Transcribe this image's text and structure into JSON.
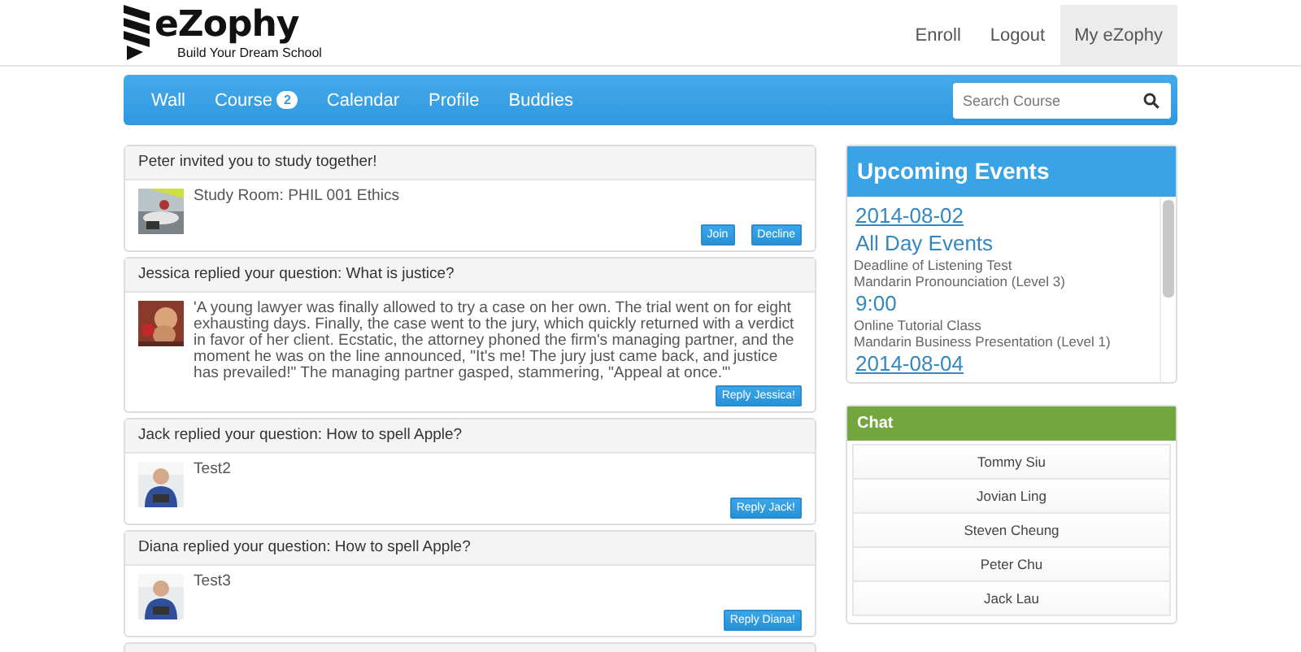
{
  "brand": {
    "name": "eZophy",
    "tagline": "Build Your Dream School"
  },
  "top_nav": [
    {
      "label": "Enroll",
      "selected": false
    },
    {
      "label": "Logout",
      "selected": false
    },
    {
      "label": "My eZophy",
      "selected": true
    }
  ],
  "main_nav": [
    {
      "label": "Wall"
    },
    {
      "label": "Course",
      "badge": "2"
    },
    {
      "label": "Calendar"
    },
    {
      "label": "Profile"
    },
    {
      "label": "Buddies"
    }
  ],
  "search": {
    "placeholder": "Search Course"
  },
  "posts": [
    {
      "title": "Peter invited you to study together!",
      "picture": {
        "kind": "picture"
      },
      "body": "Study Room: PHIL 001 Ethics",
      "buttons": [
        "Join",
        "Decline"
      ]
    },
    {
      "title": "Jessica replied your question: What is justice?",
      "picture": {
        "kind": "picture"
      },
      "body": "'A young lawyer was finally allowed to try a case on her own. The trial went on for eight exhausting days. Finally, the case went to the jury, which quickly returned with a verdict in favor of her client. Ecstatic, the attorney phoned the firm's managing partner, and the moment he was on the line announced, \"It's me! The jury just came back, and justice has prevailed!\" The managing partner gasped, stammering, \"Appeal at once.\"'",
      "buttons": [
        "Reply Jessica!"
      ]
    },
    {
      "title": "Jack replied your question: How to spell Apple?",
      "picture": {
        "kind": "picture"
      },
      "body": "Test2",
      "buttons": [
        "Reply Jack!"
      ]
    },
    {
      "title": "Diana replied your question: How to spell Apple?",
      "picture": {
        "kind": "picture"
      },
      "body": "Test3",
      "buttons": [
        "Reply Diana!"
      ]
    }
  ],
  "events": {
    "title": "Upcoming Events",
    "items": [
      {
        "kind": "date",
        "text": "2014-08-02"
      },
      {
        "kind": "heading",
        "text": "All Day Events"
      },
      {
        "kind": "text",
        "text": "Deadline of Listening Test"
      },
      {
        "kind": "text",
        "text": "Mandarin Pronounciation (Level 3)"
      },
      {
        "kind": "heading",
        "text": "9:00"
      },
      {
        "kind": "text",
        "text": "Online Tutorial Class"
      },
      {
        "kind": "text",
        "text": "Mandarin Business Presentation (Level 1)"
      },
      {
        "kind": "date",
        "text": "2014-08-04"
      }
    ]
  },
  "chat": {
    "title": "Chat",
    "buddies": [
      "Tommy Siu",
      "Jovian Ling",
      "Steven Cheung",
      "Peter Chu",
      "Jack Lau"
    ]
  }
}
